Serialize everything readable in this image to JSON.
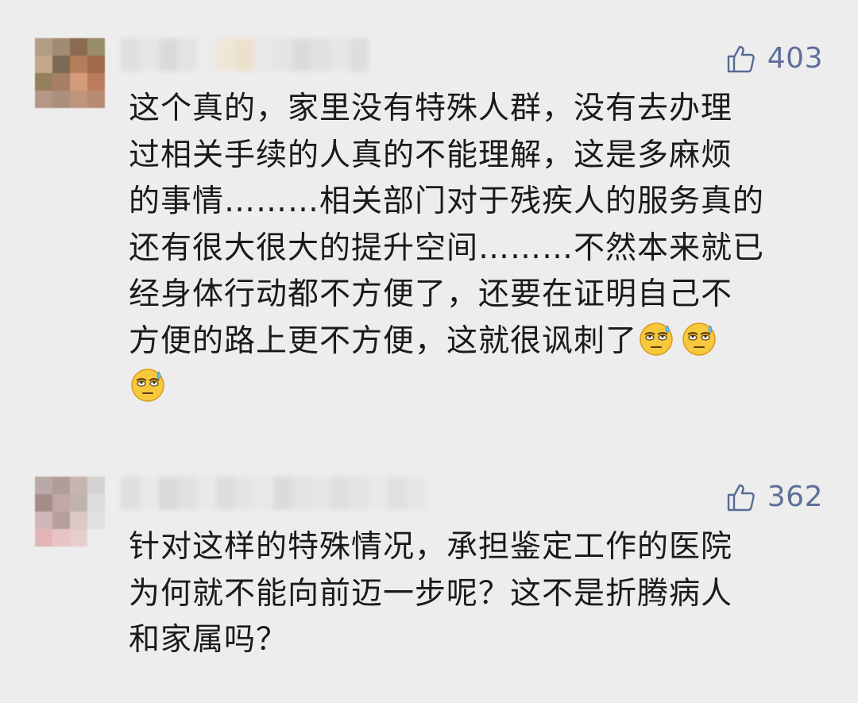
{
  "comments": [
    {
      "likes": "403",
      "lines": [
        "这个真的，家里没有特殊人群，没有去办理",
        "过相关手续的人真的不能理解，这是多麻烦",
        "的事情………相关部门对于残疾人的服务真的",
        "还有很大很大的提升空间………不然本来就已",
        "经身体行动都不方便了，还要在证明自己不",
        "方便的路上更不方便，这就很讽刺了"
      ],
      "emoji": "sweat-roll-eyes-emoji",
      "avatar_colors": [
        "#b49d85",
        "#a28b73",
        "#8b6a52",
        "#9a8d6a",
        "#c4a98a",
        "#7c6b55",
        "#b57d5c",
        "#a06948",
        "#94805a",
        "#a67f65",
        "#d49c7a",
        "#bb7c5c",
        "#b59787",
        "#ab8f7d",
        "#c0957d",
        "#b88b73"
      ],
      "username_colors": [
        "#dedede",
        "#e6e6e6",
        "#d9d9d9",
        "#e2e2e2",
        "#ececec",
        "#f0e6d8",
        "#ece0c9",
        "#e8e8e8",
        "#e4e4e4",
        "#dadada",
        "#e0e0e0",
        "#e6e6e6",
        "#dcdcdc"
      ]
    },
    {
      "likes": "362",
      "lines": [
        "针对这样的特殊情况，承担鉴定工作的医院",
        "为何就不能向前迈一步呢？这不是折腾病人",
        "和家属吗？"
      ],
      "avatar_colors": [
        "#b9aaa8",
        "#b19c98",
        "#c7b5b1",
        "#d5d2d0",
        "#a58d8a",
        "#c1a8a4",
        "#bfb3b0",
        "#dcdcdc",
        "#cfb7b8",
        "#b6a09e",
        "#dcc8c8",
        "#e0e0e0",
        "#e3b5ba",
        "#e8c4c6",
        "#e6cdd0",
        "#ececec"
      ],
      "username_colors": [
        "#dedede",
        "#e8e8e8",
        "#d8d8d8",
        "#e0e0e0",
        "#e9e9e9",
        "#dcdcdc",
        "#e4e4e4",
        "#e8e8e8",
        "#dadada",
        "#e2e2e2",
        "#e6e6e6",
        "#dddddd",
        "#e3e3e3",
        "#e9e9e9",
        "#dfdfdf",
        "#e5e5e5"
      ]
    }
  ],
  "colors": {
    "background": "#ededed",
    "text": "#1a1a1a",
    "like": "#576b95"
  }
}
